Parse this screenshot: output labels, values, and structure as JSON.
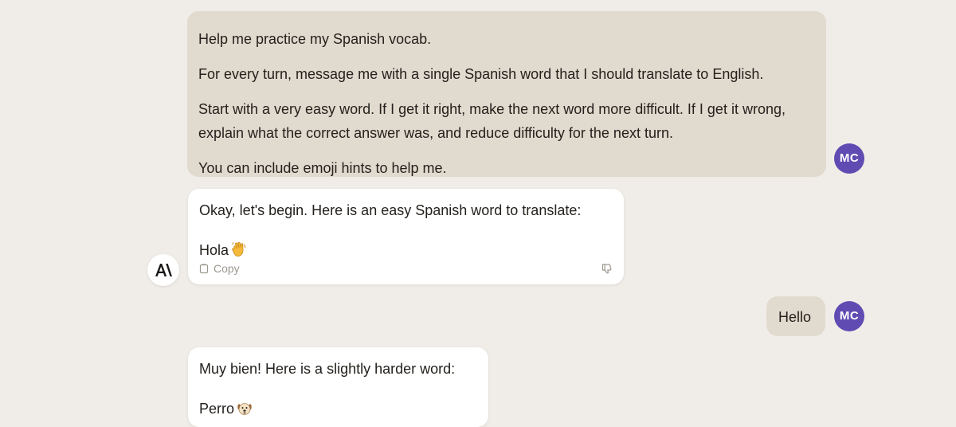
{
  "conversation": {
    "prompt": {
      "avatar_initials": "MC",
      "lines": [
        "Help me practice my Spanish vocab.",
        "For every turn, message me with a single Spanish word that I should translate to English.",
        "Start with a very easy word. If I get it right, make the next word more difficult. If I get it wrong, explain what the correct answer was, and reduce difficulty for the next turn.",
        "You can include emoji hints to help me."
      ]
    },
    "assistant_1": {
      "intro": "Okay, let's begin. Here is an easy Spanish word to translate:",
      "word": "Hola",
      "emoji_hint": "waving-hand-icon",
      "copy_label": "Copy"
    },
    "user_reply": {
      "text": "Hello",
      "avatar_initials": "MC"
    },
    "assistant_2": {
      "intro": "Muy bien! Here is a slightly harder word:",
      "word": "Perro",
      "emoji_hint": "dog-face-icon"
    }
  },
  "colors": {
    "background": "#f0ede8",
    "user_bubble": "#e1dace",
    "assistant_bubble": "#ffffff",
    "avatar": "#5f4bb2",
    "muted_text": "#9c978f"
  }
}
